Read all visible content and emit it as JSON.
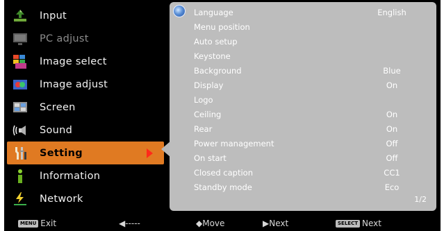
{
  "menu": {
    "items": [
      {
        "label": "Input",
        "icon": "input-icon",
        "state": "normal"
      },
      {
        "label": "PC adjust",
        "icon": "pc-adjust-icon",
        "state": "disabled"
      },
      {
        "label": "Image select",
        "icon": "image-select-icon",
        "state": "normal"
      },
      {
        "label": "Image adjust",
        "icon": "image-adjust-icon",
        "state": "normal"
      },
      {
        "label": "Screen",
        "icon": "screen-icon",
        "state": "normal"
      },
      {
        "label": "Sound",
        "icon": "sound-icon",
        "state": "normal"
      },
      {
        "label": "Setting",
        "icon": "setting-icon",
        "state": "active"
      },
      {
        "label": "Information",
        "icon": "information-icon",
        "state": "normal"
      },
      {
        "label": "Network",
        "icon": "network-icon",
        "state": "normal"
      }
    ]
  },
  "settings": {
    "rows": [
      {
        "label": "Language",
        "value": "English"
      },
      {
        "label": "Menu position",
        "value": ""
      },
      {
        "label": "Auto setup",
        "value": ""
      },
      {
        "label": "Keystone",
        "value": ""
      },
      {
        "label": "Background",
        "value": "Blue"
      },
      {
        "label": "Display",
        "value": "On"
      },
      {
        "label": "Logo",
        "value": ""
      },
      {
        "label": "Ceiling",
        "value": "On"
      },
      {
        "label": "Rear",
        "value": "On"
      },
      {
        "label": "Power management",
        "value": "Off"
      },
      {
        "label": "On start",
        "value": "Off"
      },
      {
        "label": "Closed caption",
        "value": "CC1"
      },
      {
        "label": "Standby mode",
        "value": "Eco"
      }
    ],
    "page_indicator": "1/2"
  },
  "bottom_bar": {
    "exit_key": "MENU",
    "exit_label": "Exit",
    "back_hint": "◀-----",
    "move_hint": "◆Move",
    "next_arrow_hint": "▶Next",
    "select_key": "SELECT",
    "select_label": "Next"
  },
  "colors": {
    "active_bg": "#e07a22",
    "panel_bg": "#bdbdbd",
    "arrow": "#ff2a1a"
  }
}
